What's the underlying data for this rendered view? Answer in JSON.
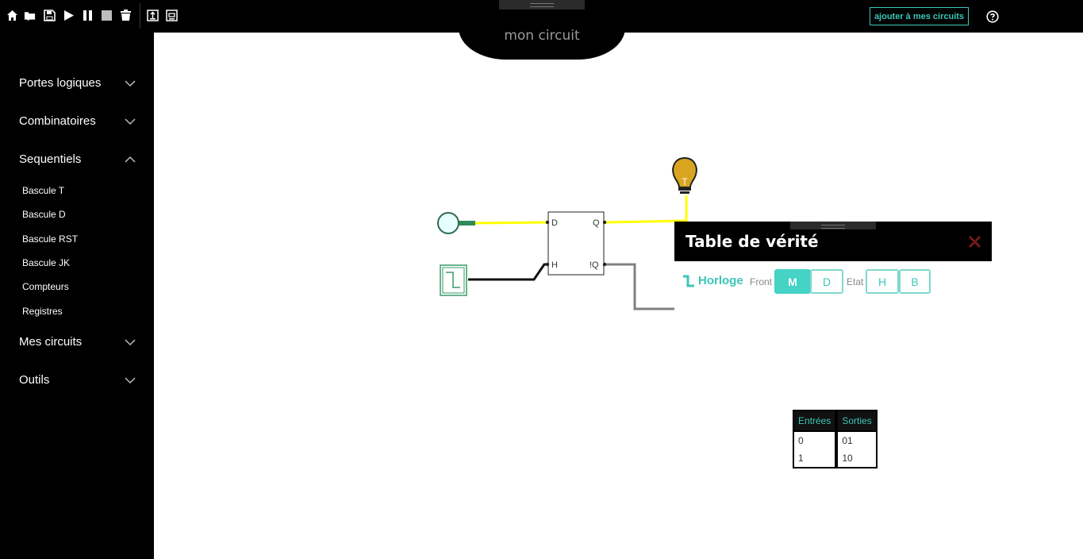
{
  "toolbar": {
    "icons": [
      "home-icon",
      "open-folder-icon",
      "save-icon",
      "play-icon",
      "pause-icon",
      "stop-icon",
      "trash-icon",
      "export-icon",
      "import-icon"
    ],
    "add_button": "ajouter à mes circuits",
    "help_icon": "help-icon"
  },
  "circuit": {
    "title": "mon circuit"
  },
  "sidebar": {
    "sections": [
      {
        "label": "Portes logiques",
        "expanded": false
      },
      {
        "label": "Combinatoires",
        "expanded": false
      },
      {
        "label": "Sequentiels",
        "expanded": true
      },
      {
        "label": "Mes circuits",
        "expanded": false
      },
      {
        "label": "Outils",
        "expanded": false
      }
    ],
    "sequentiels_items": [
      "Bascule T",
      "Bascule D",
      "Bascule RST",
      "Bascule JK",
      "Compteurs",
      "Registres"
    ]
  },
  "flipflop": {
    "pins": {
      "d": "D",
      "h": "H",
      "q": "Q",
      "nq": "!Q"
    }
  },
  "lamp": {
    "label": "T"
  },
  "truth_table": {
    "title": "Table de vérité",
    "clock_label": "Horloge",
    "front_label": "Front",
    "front_options": [
      "M",
      "D"
    ],
    "front_selected": "M",
    "etat_label": "Etat",
    "etat_options": [
      "H",
      "B"
    ],
    "headers": [
      "Entrées",
      "Sorties"
    ],
    "rows": [
      [
        "0",
        "01"
      ],
      [
        "1",
        "10"
      ]
    ]
  },
  "colors": {
    "accent": "#3ac7b8",
    "wire_active": "#ffff00",
    "wire_idle": "#808080",
    "lamp": "#d9a520",
    "close": "#e03030"
  }
}
